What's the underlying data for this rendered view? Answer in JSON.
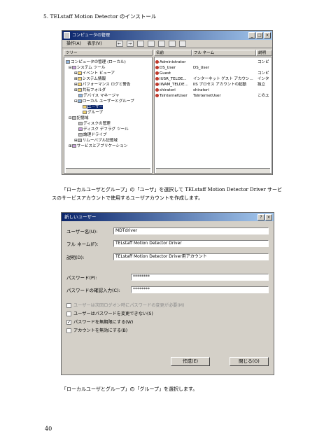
{
  "page_heading": "5. TELstaff Motion Detector のインストール",
  "computer_management": {
    "title": "コンピュータの管理",
    "title_buttons": [
      "_",
      "□",
      "×"
    ],
    "menu": [
      "操作(A)",
      "表示(V)"
    ],
    "toolbar_icons": [
      "back-icon",
      "forward-icon",
      "up-icon",
      "console-icon",
      "refresh-icon",
      "export-icon",
      "help-icon"
    ],
    "columns": {
      "tree": "ツリー",
      "name": "名前",
      "fullname": "フル ネーム",
      "desc": "説明"
    },
    "tree": [
      {
        "label": "コンピュータの管理 (ローカル)",
        "icon": "computer-icon"
      },
      {
        "label": "システム ツール",
        "icon": "tools-icon"
      },
      {
        "label": "イベント ビューア",
        "icon": "event-viewer-icon"
      },
      {
        "label": "システム情報",
        "icon": "system-info-icon"
      },
      {
        "label": "パフォーマンス ログと警告",
        "icon": "performance-icon"
      },
      {
        "label": "共有フォルダ",
        "icon": "shared-folder-icon"
      },
      {
        "label": "デバイス マネージャ",
        "icon": "device-manager-icon"
      },
      {
        "label": "ローカル ユーザーとグループ",
        "icon": "users-groups-icon"
      },
      {
        "label": "ユーザー",
        "icon": "folder-icon"
      },
      {
        "label": "グループ",
        "icon": "folder-icon"
      },
      {
        "label": "記憶域",
        "icon": "storage-icon"
      },
      {
        "label": "ディスクの管理",
        "icon": "disk-icon"
      },
      {
        "label": "ディスク デフラグ ツール",
        "icon": "defrag-icon"
      },
      {
        "label": "論理ドライブ",
        "icon": "drive-icon"
      },
      {
        "label": "リムーバブル記憶域",
        "icon": "removable-icon"
      },
      {
        "label": "サービスとアプリケーション",
        "icon": "services-icon"
      }
    ],
    "users": [
      {
        "name": "Administrator",
        "fullname": "",
        "desc": "コンピ"
      },
      {
        "name": "DS_User",
        "fullname": "DS_User",
        "desc": ""
      },
      {
        "name": "Guest",
        "fullname": "",
        "desc": "コンピ"
      },
      {
        "name": "IUSR_TELDE...",
        "fullname": "インターネット ゲスト アカウン...",
        "desc": "インタ"
      },
      {
        "name": "IWAM_TELDE...",
        "fullname": "IIS プロセス アカウントの起動",
        "desc": "独立"
      },
      {
        "name": "shiratori",
        "fullname": "shiratori",
        "desc": ""
      },
      {
        "name": "TsInternetUser",
        "fullname": "TsInternetUser",
        "desc": "このユ"
      }
    ]
  },
  "para1_line1": "「ローカルユーザとグループ」の「ユーザ」を選択して TELstaff Motion Detector Driver サービ",
  "para1_line2": "スのサービスアカウントで使用するユーザアカウントを作成します。",
  "new_user_dialog": {
    "title": "新しいユーザー",
    "help_btn": "?",
    "close_btn": "×",
    "username_label": "ユーザー名(U):",
    "username_value": "MDTdriver",
    "fullname_label": "フル ネーム(F):",
    "fullname_value": "TELstaff Motion Detector Driver",
    "description_label": "説明(D):",
    "description_value": "TELstaff Motion Detector Driver用アカウント",
    "password_label": "パスワード(P):",
    "password_value": "********",
    "confirm_label": "パスワードの確認入力(C):",
    "confirm_value": "********",
    "check_must_change": "ユーザーは次回ログオン時にパスワードの変更が必要(M)",
    "check_cannot_change": "ユーザーはパスワードを変更できない(S)",
    "check_never_expires": "パスワードを無期限にする(W)",
    "check_disabled": "アカウントを無効にする(B)",
    "create_button": "作成(E)",
    "close_button": "閉じる(O)",
    "check_mark": "✓"
  },
  "para2": "「ローカルユーザとグループ」の「グループ」を選択します。",
  "page_number": "40"
}
